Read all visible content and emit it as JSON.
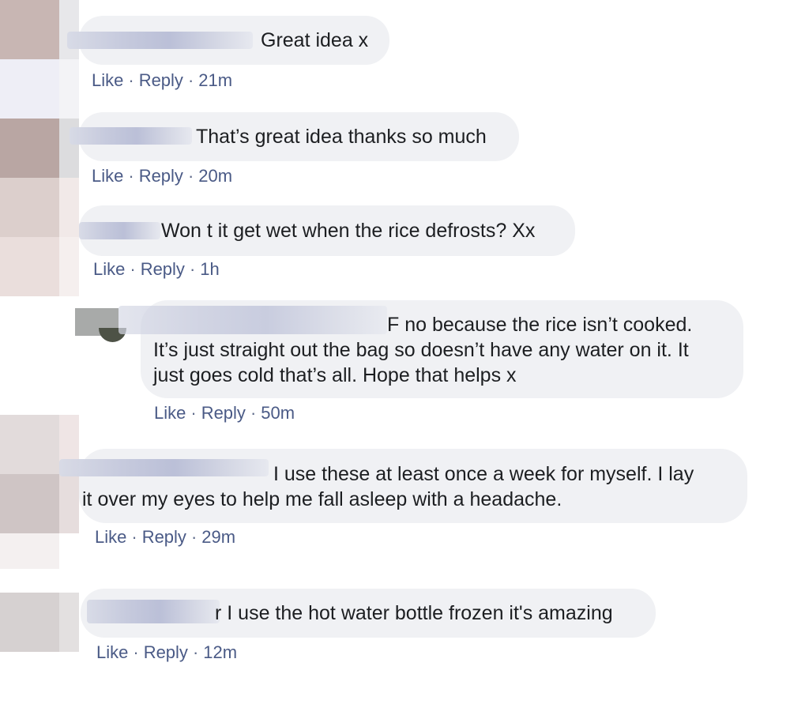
{
  "comments": [
    {
      "text": "Great idea x",
      "like": "Like",
      "reply": "Reply",
      "time": "21m"
    },
    {
      "text": "That’s great idea thanks so much",
      "like": "Like",
      "reply": "Reply",
      "time": "20m"
    },
    {
      "text": "Won t it get wet when the rice defrosts? Xx",
      "like": "Like",
      "reply": "Reply",
      "time": "1h"
    },
    {
      "line1": "F no because the rice isn’t cooked.",
      "line2": "It’s just straight out the bag so doesn’t have any water on it. It",
      "line3": "just goes cold that’s all. Hope that helps x",
      "like": "Like",
      "reply": "Reply",
      "time": "50m"
    },
    {
      "line1": "I use these at least once a week for myself. I lay",
      "line2": "it over my eyes to help me fall asleep with a headache.",
      "like": "Like",
      "reply": "Reply",
      "time": "29m"
    },
    {
      "text": "r I use the hot water bottle frozen it's amazing",
      "like": "Like",
      "reply": "Reply",
      "time": "12m"
    }
  ],
  "separator": "·",
  "colors": {
    "bubble": "#f0f1f4",
    "link": "#4a5a86",
    "text": "#1c1e21"
  }
}
